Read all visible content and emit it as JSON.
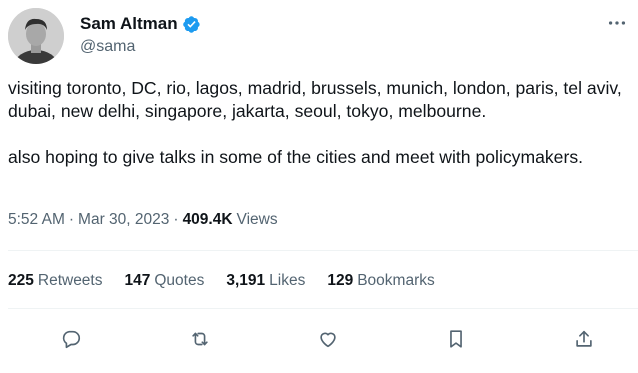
{
  "author": {
    "display_name": "Sam Altman",
    "handle": "@sama",
    "avatar_icon": "profile-photo",
    "verified_icon": "verified-badge-icon",
    "verified_color": "#1d9bf0"
  },
  "tweet": {
    "paragraph1": "visiting toronto, DC, rio, lagos, madrid, brussels, munich, london, paris, tel aviv, dubai, new delhi, singapore, jakarta, seoul, tokyo, melbourne.",
    "paragraph2": "also hoping to give talks in some of the cities and meet with policymakers."
  },
  "meta": {
    "time": "5:52 AM",
    "separator": "·",
    "date": "Mar 30, 2023",
    "views_count": "409.4K",
    "views_label": "Views"
  },
  "stats": {
    "retweets_count": "225",
    "retweets_label": "Retweets",
    "quotes_count": "147",
    "quotes_label": "Quotes",
    "likes_count": "3,191",
    "likes_label": "Likes",
    "bookmarks_count": "129",
    "bookmarks_label": "Bookmarks"
  },
  "actions": {
    "icons": [
      "reply-icon",
      "retweet-icon",
      "like-icon",
      "bookmark-icon",
      "share-icon"
    ],
    "icon_color": "#536471"
  },
  "colors": {
    "text_primary": "#0f1419",
    "text_secondary": "#536471",
    "divider": "#eff3f4"
  }
}
